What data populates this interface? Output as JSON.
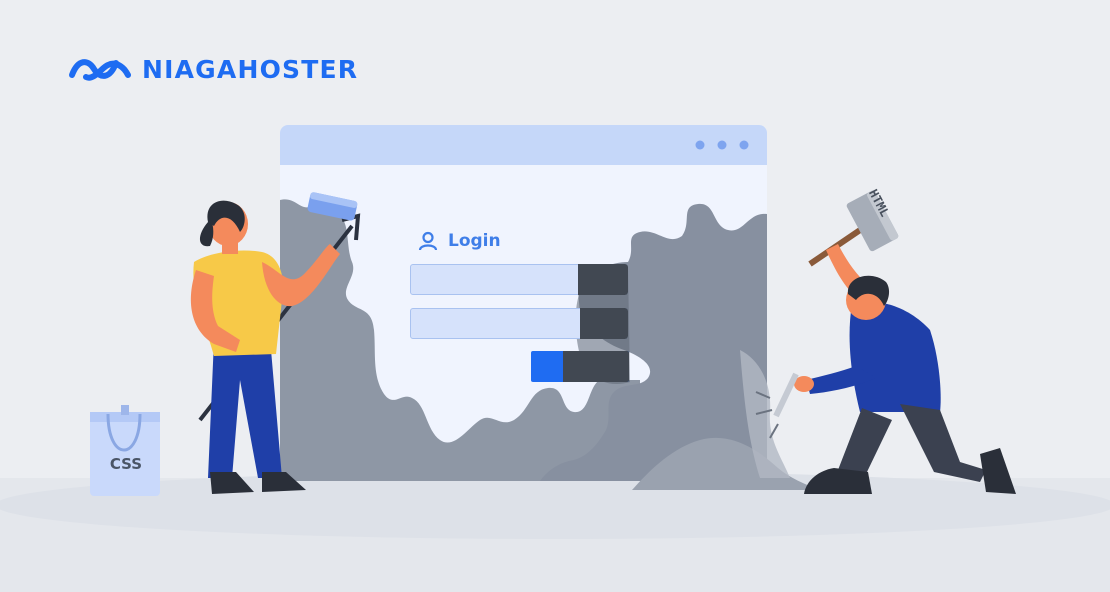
{
  "brand": {
    "name": "NIAGAHOSTER",
    "color": "#1e6cf2"
  },
  "login_form": {
    "title": "Login",
    "icon": "user-icon",
    "accent": "#3f7ee8",
    "button_color": "#1f6cf2"
  },
  "props": {
    "bag_label": "CSS",
    "hammer_label": "HTML"
  },
  "icons": [
    "logo-wave-icon",
    "user-icon",
    "window-dot-icon"
  ]
}
